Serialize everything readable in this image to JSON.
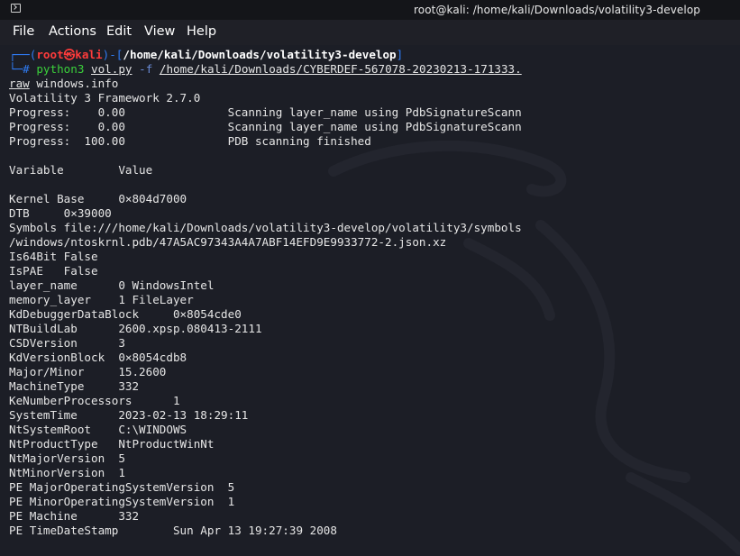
{
  "window": {
    "title": "root@kali: /home/kali/Downloads/volatility3-develop"
  },
  "menu": [
    "File",
    "Actions",
    "Edit",
    "View",
    "Help"
  ],
  "prompt": {
    "open": "┌──(",
    "user": "root㉿kali",
    "mid": ")-[",
    "path": "/home/kali/Downloads/volatility3-develop",
    "close": "]",
    "hash": "└─#",
    "command": "python3",
    "script": "vol.py",
    "flag": "-f",
    "file_part1": "/home/kali/Downloads/CYBERDEF-567078-20230213-171333.",
    "file_part2": "raw",
    "plugin": " windows.info"
  },
  "output": [
    "Volatility 3 Framework 2.7.0",
    "Progress:    0.00               Scanning layer_name using PdbSignatureScann",
    "Progress:    0.00               Scanning layer_name using PdbSignatureScann",
    "Progress:  100.00               PDB scanning finished",
    "",
    "Variable        Value",
    "",
    "Kernel Base     0×804d7000",
    "DTB     0×39000",
    "Symbols file:///home/kali/Downloads/volatility3-develop/volatility3/symbols",
    "/windows/ntoskrnl.pdb/47A5AC97343A4A7ABF14EFD9E9933772-2.json.xz",
    "Is64Bit False",
    "IsPAE   False",
    "layer_name      0 WindowsIntel",
    "memory_layer    1 FileLayer",
    "KdDebuggerDataBlock     0×8054cde0",
    "NTBuildLab      2600.xpsp.080413-2111",
    "CSDVersion      3",
    "KdVersionBlock  0×8054cdb8",
    "Major/Minor     15.2600",
    "MachineType     332",
    "KeNumberProcessors      1",
    "SystemTime      2023-02-13 18:29:11",
    "NtSystemRoot    C:\\WINDOWS",
    "NtProductType   NtProductWinNt",
    "NtMajorVersion  5",
    "NtMinorVersion  1",
    "PE MajorOperatingSystemVersion  5",
    "PE MinorOperatingSystemVersion  1",
    "PE Machine      332",
    "PE TimeDateStamp        Sun Apr 13 19:27:39 2008"
  ],
  "colors": {
    "background": "#1c1e26",
    "prompt_blue": "#2f7cf5",
    "prompt_red": "#ff3b3b",
    "command_green": "#3bd13b"
  },
  "icons": {
    "window": "terminal-icon"
  }
}
